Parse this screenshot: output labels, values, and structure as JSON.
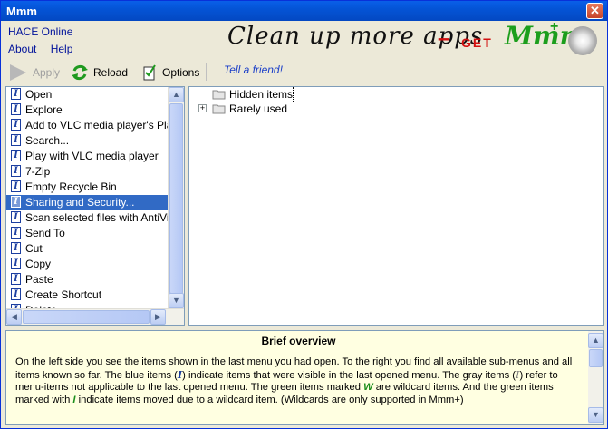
{
  "window": {
    "title": "Mmm",
    "close_label": "✕"
  },
  "menu": {
    "hace_online": "HACE Online",
    "about": "About",
    "help": "Help"
  },
  "banner": {
    "text": "Clean up more apps",
    "dash": "–",
    "get": "GET",
    "mmm": "Mmm",
    "plus": "+"
  },
  "toolbar": {
    "apply": "Apply",
    "reload": "Reload",
    "options": "Options",
    "tell": "Tell a friend!"
  },
  "list": {
    "items": [
      "Open",
      "Explore",
      "Add to VLC media player's Playlis",
      "Search...",
      "Play with VLC media player",
      "7-Zip",
      "Empty Recycle Bin",
      "Sharing and Security...",
      "Scan selected files with AntiVir",
      "Send To",
      "Cut",
      "Copy",
      "Paste",
      "Create Shortcut",
      "Delete"
    ],
    "selected_index": 7
  },
  "tree": {
    "nodes": [
      {
        "label": "Hidden items",
        "expandable": false
      },
      {
        "label": "Rarely used",
        "expandable": true
      }
    ]
  },
  "overview": {
    "title": "Brief overview",
    "p1": "On the left side you see the items shown in the last menu you had open. To the right you find all available sub-menus and all items known so far. The blue items (",
    "p2": ") indicate items that were visible in the last opened menu. The gray items (",
    "p3": ") refer to menu-items not applicable to the last opened menu. The green items marked ",
    "p4": " are wildcard items. And the green items marked with ",
    "p5": " indicate items moved due to a wildcard item. (Wildcards are only supported in Mmm+)",
    "icon_i": "I",
    "icon_w": "W"
  },
  "colors": {
    "accent": "#316ac5",
    "link": "#1a3ec8",
    "panel_bg": "#ffffe1",
    "titlebar": "#0454d6"
  }
}
